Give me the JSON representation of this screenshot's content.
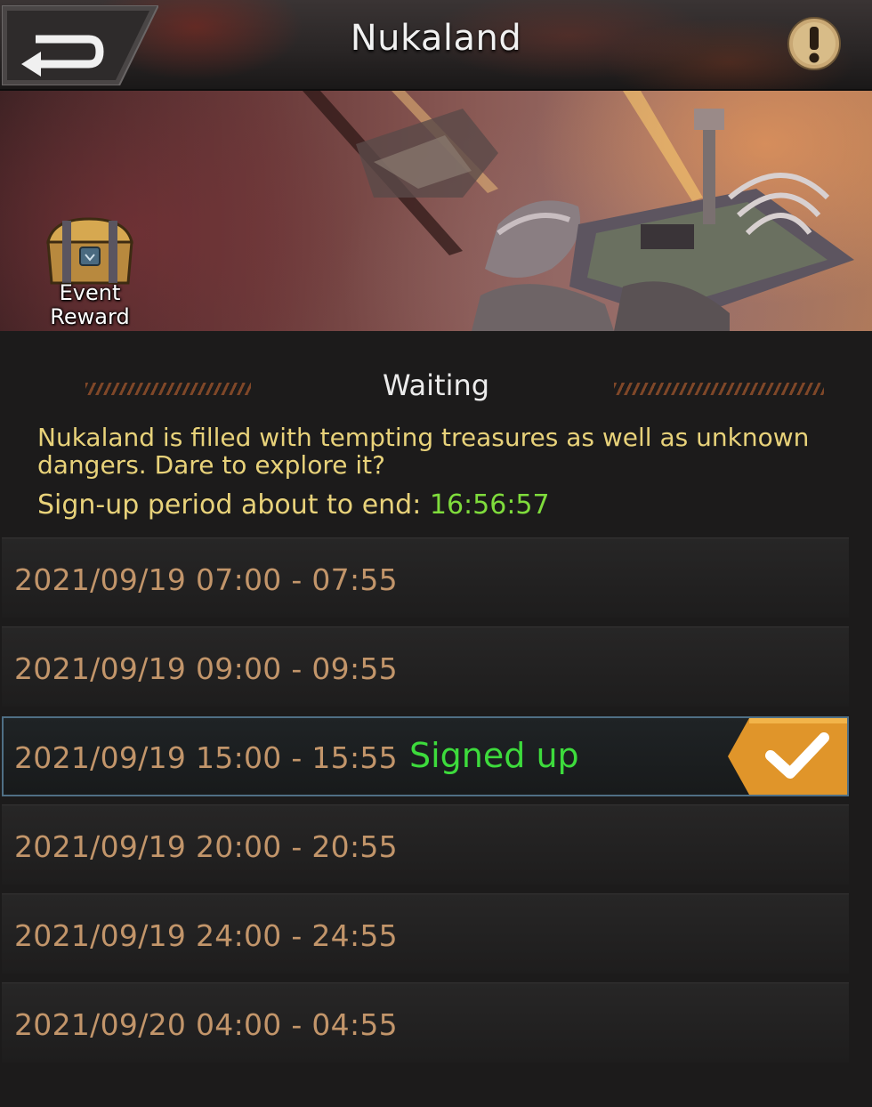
{
  "header": {
    "title": "Nukaland",
    "back_icon": "back-arrow-icon",
    "info_icon": "exclamation-info-icon"
  },
  "banner": {
    "reward_icon": "treasure-chest-icon",
    "reward_label": "Event Reward"
  },
  "status": {
    "title": "Waiting",
    "description": "Nukaland is filled with tempting treasures as well as unknown dangers. Dare to explore it?",
    "signup_label": "Sign-up period about to end: ",
    "countdown": "16:56:57"
  },
  "slots": [
    {
      "time": "2021/09/19 07:00 - 07:55",
      "signed": false
    },
    {
      "time": "2021/09/19 09:00 - 09:55",
      "signed": false
    },
    {
      "time": "2021/09/19 15:00 - 15:55",
      "signed": true,
      "signed_label": "Signed up"
    },
    {
      "time": "2021/09/19 20:00 - 20:55",
      "signed": false
    },
    {
      "time": "2021/09/19 24:00 - 24:55",
      "signed": false
    },
    {
      "time": "2021/09/20 04:00 - 04:55",
      "signed": false
    }
  ],
  "colors": {
    "description": "#e8d27a",
    "countdown": "#7fdc3c",
    "slot_time": "#c2956a",
    "signed": "#3ddb3c",
    "check_badge": "#e0952a"
  }
}
